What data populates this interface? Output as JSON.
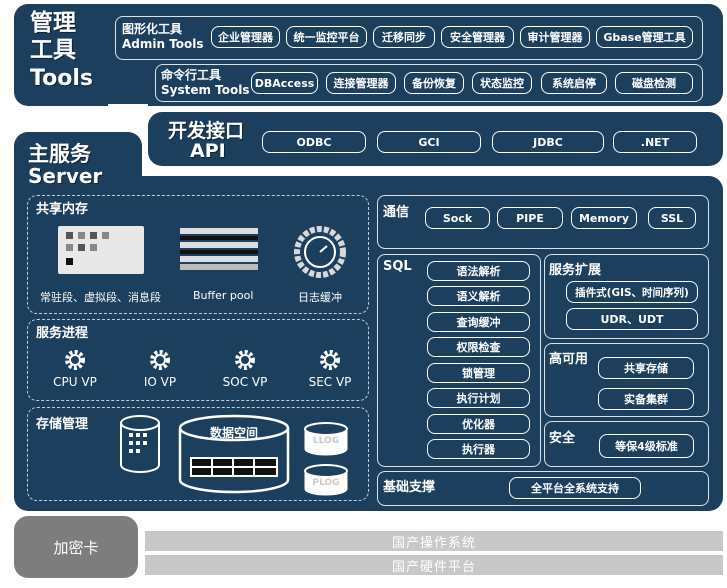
{
  "tools": {
    "title_cn": "管理\n工具",
    "title_en": "Tools",
    "gui": {
      "label_cn": "图形化工具",
      "label_en": "Admin Tools",
      "items": [
        "企业管理器",
        "统一监控平台",
        "迁移同步",
        "安全管理器",
        "审计管理器",
        "Gbase管理工具"
      ]
    },
    "cli": {
      "label_cn": "命令行工具",
      "label_en": "System Tools",
      "items": [
        "DBAccess",
        "连接管理器",
        "备份恢复",
        "状态监控",
        "系统启停",
        "磁盘检测"
      ]
    }
  },
  "api": {
    "title_cn": "开发接口",
    "title_en": "API",
    "items": [
      "ODBC",
      "GCI",
      "JDBC",
      ".NET"
    ]
  },
  "server": {
    "title_cn": "主服务",
    "title_en": "Server",
    "shared_memory": {
      "title": "共享内存",
      "labels": [
        "常驻段、虚拟段、消息段",
        "Buffer pool",
        "日志缓冲"
      ]
    },
    "processes": {
      "title": "服务进程",
      "items": [
        "CPU VP",
        "IO VP",
        "SOC VP",
        "SEC VP"
      ]
    },
    "storage": {
      "title": "存储管理",
      "data_space": "数据空间",
      "llog": "LLOG",
      "plog": "PLOG"
    },
    "comm": {
      "title": "通信",
      "items": [
        "Sock",
        "PIPE",
        "Memory",
        "SSL"
      ]
    },
    "sql": {
      "title": "SQL",
      "items": [
        "语法解析",
        "语义解析",
        "查询缓冲",
        "权限检查",
        "锁管理",
        "执行计划",
        "优化器",
        "执行器"
      ]
    },
    "extension": {
      "title": "服务扩展",
      "items": [
        "插件式(GIS、时间序列)",
        "UDR、UDT"
      ]
    },
    "ha": {
      "title": "高可用",
      "items": [
        "共享存储",
        "实备集群"
      ]
    },
    "security": {
      "title": "安全",
      "items": [
        "等保4级标准"
      ]
    },
    "foundation": {
      "title": "基础支撑",
      "items": [
        "全平台全系统支持"
      ]
    }
  },
  "bottom": {
    "card": "加密卡",
    "os": "国产操作系统",
    "hw": "国产硬件平台"
  },
  "colors": {
    "panel": "#1c3f5e",
    "gray": "#c8c8c8",
    "card": "#7d7d7d"
  }
}
